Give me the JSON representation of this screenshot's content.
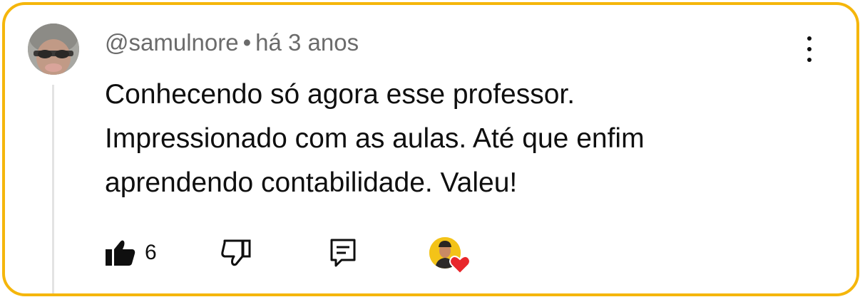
{
  "comment": {
    "author": "@samulnore",
    "separator": "•",
    "timestamp": "há 3 anos",
    "lines": [
      "Conhecendo só agora esse professor.",
      "Impressionado com as aulas. Até que enfim",
      "aprendendo contabilidade. Valeu!"
    ]
  },
  "actions": {
    "like_count": "6",
    "like_icon": "thumbs-up-filled-icon",
    "dislike_icon": "thumbs-down-outline-icon",
    "reply_icon": "comment-reply-icon",
    "creator_heart_icon": "creator-heart-icon"
  },
  "colors": {
    "frame_border": "#f5b60b",
    "text_primary": "#0f0f0f",
    "text_secondary": "#6b6b6b",
    "heart_red": "#e8262b",
    "creator_avatar_bg": "#f3c318"
  }
}
